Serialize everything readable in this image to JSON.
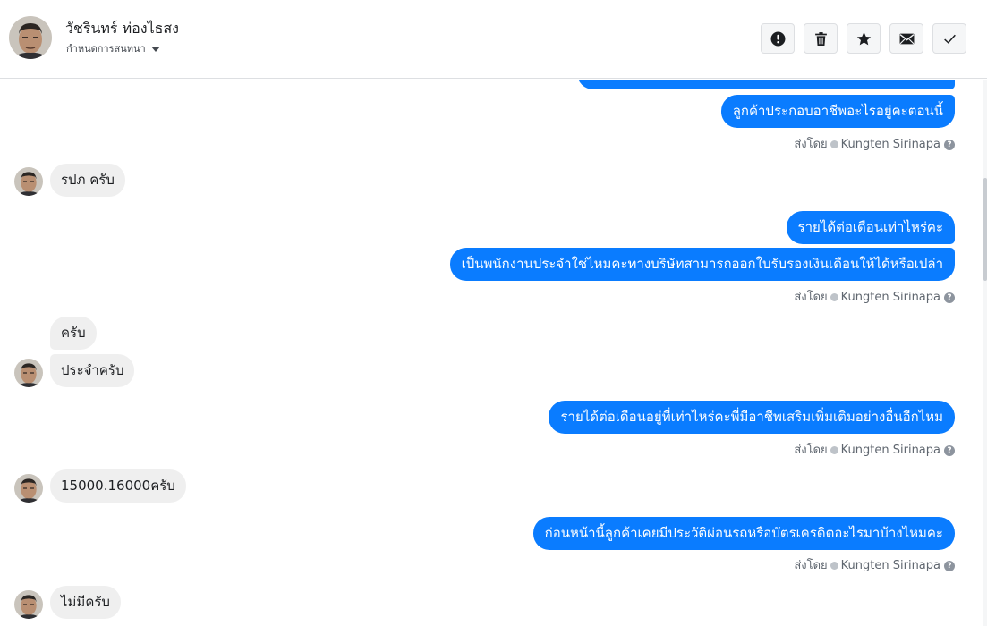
{
  "header": {
    "contact_name": "วัชรินทร์ ท่องไธสง",
    "subtitle": "กำหนดการสนทนา",
    "avatar_icon": "user-avatar-icon",
    "actions": [
      {
        "name": "report-button",
        "icon": "exclamation-circle-icon"
      },
      {
        "name": "delete-button",
        "icon": "trash-icon"
      },
      {
        "name": "star-button",
        "icon": "star-icon"
      },
      {
        "name": "mark-unread-button",
        "icon": "envelope-icon"
      },
      {
        "name": "mark-done-button",
        "icon": "checkmark-icon"
      }
    ]
  },
  "sent_by": {
    "prefix": "ส่งโดย",
    "sender": "Kungten Sirinapa",
    "help_glyph": "?"
  },
  "messages": [
    {
      "dir": "out",
      "text": "ลูกค้าประกอบอาชีพอะไรอยู่คะตอนนี้"
    },
    {
      "dir": "in",
      "text": "รปภ ครับ"
    },
    {
      "dir": "out",
      "text": "รายได้ต่อเดือนเท่าไหร่คะ"
    },
    {
      "dir": "out",
      "text": "เป็นพนักงานประจำใช่ไหมคะทางบริษัทสามารถออกใบรับรองเงินเดือนให้ได้หรือเปล่า"
    },
    {
      "dir": "in",
      "text": "ครับ"
    },
    {
      "dir": "in",
      "text": "ประจำครับ"
    },
    {
      "dir": "out",
      "text": "รายได้ต่อเดือนอยู่ที่เท่าไหร่คะพี่มีอาชีพเสริมเพิ่มเติมอย่างอื่นอีกไหม"
    },
    {
      "dir": "in",
      "text": "15000.16000ครับ"
    },
    {
      "dir": "out",
      "text": "ก่อนหน้านี้ลูกค้าเคยมีประวัติผ่อนรถหรือบัตรเครดิตอะไรมาบ้างไหมคะ"
    },
    {
      "dir": "in",
      "text": "ไม่มีครับ"
    }
  ],
  "colors": {
    "outgoing_bubble": "#0a7cff",
    "incoming_bubble": "#efefef"
  }
}
